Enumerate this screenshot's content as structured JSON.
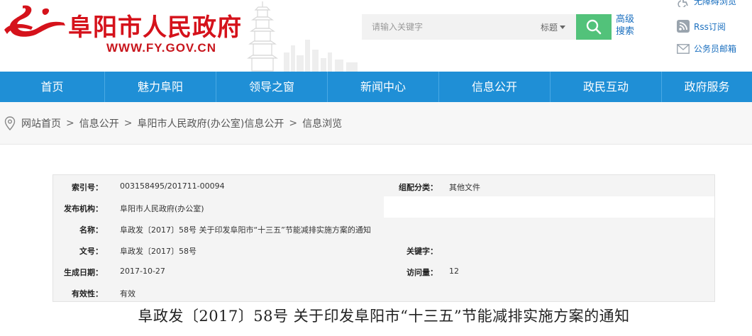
{
  "header": {
    "site_name": "阜阳市人民政府",
    "site_url": "WWW.FY.GOV.CN",
    "search": {
      "placeholder": "请输入关键字",
      "scope_label": "标题",
      "advanced_label": "高级搜索"
    },
    "quick_links": [
      "无障碍浏览",
      "Rss订阅",
      "公务员邮箱"
    ]
  },
  "nav": {
    "items": [
      "首页",
      "魅力阜阳",
      "领导之窗",
      "新闻中心",
      "信息公开",
      "政民互动",
      "政府服务"
    ]
  },
  "breadcrumb": {
    "items": [
      "网站首页",
      "信息公开",
      "阜阳市人民政府(办公室)信息公开",
      "信息浏览"
    ],
    "separator": ">"
  },
  "info_table": {
    "index_label": "索引号：",
    "index_value": "003158495/201711-00094",
    "category_label": "组配分类：",
    "category_value": "其他文件",
    "publisher_label": "发布机构：",
    "publisher_value": "阜阳市人民政府(办公室)",
    "name_label": "名称：",
    "name_value": "阜政发〔2017〕58号 关于印发阜阳市“十三五”节能减排实施方案的通知",
    "docno_label": "文号：",
    "docno_value": "阜政发〔2017〕58号",
    "keywords_label": "关键字：",
    "keywords_value": "",
    "date_label": "生成日期：",
    "date_value": "2017-10-27",
    "visits_label": "访问量：",
    "visits_value": "12",
    "validity_label": "有效性：",
    "validity_value": "有效"
  },
  "article": {
    "title": "阜政发〔2017〕58号 关于印发阜阳市“十三五”节能减排实施方案的通知"
  },
  "colors": {
    "brand_red": "#d5121b",
    "nav_blue": "#1f8fd6",
    "search_green": "#52c27a",
    "link_blue": "#1a6fbf"
  }
}
